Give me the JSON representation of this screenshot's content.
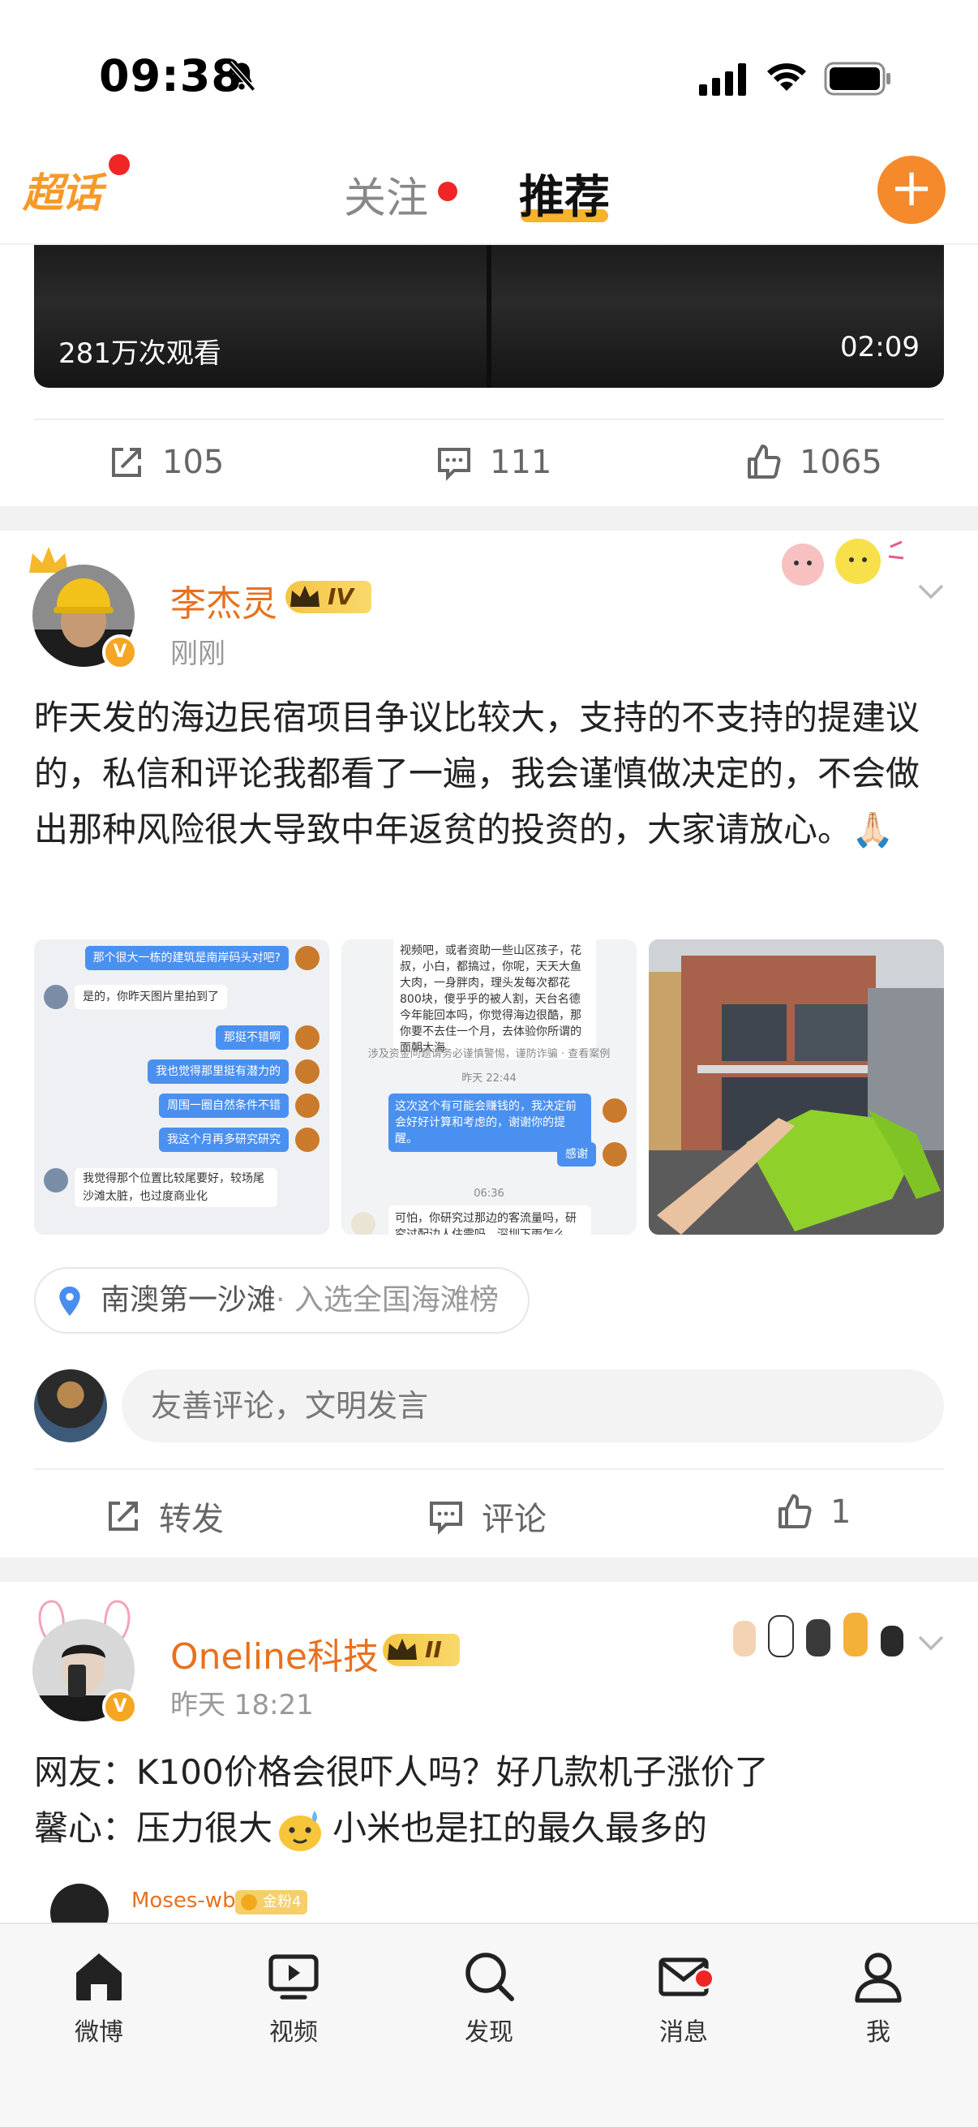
{
  "status_bar": {
    "time": "09:38"
  },
  "top_nav": {
    "chaohua_label": "超话",
    "tab_follow": "关注",
    "tab_recommend": "推荐",
    "plus": "+"
  },
  "video_card": {
    "views": "281万次观看",
    "duration": "02:09"
  },
  "post1_actions": {
    "repost": "105",
    "comment": "111",
    "like": "1065"
  },
  "post2": {
    "name": "李杰灵",
    "level": "IV",
    "time": "刚刚",
    "text": "昨天发的海边民宿项目争议比较大，支持的不支持的提建议的，私信和评论我都看了一遍，我会谨慎做决定的，不会做出那种风险很大导致中年返贫的投资的，大家请放心。🙏🏻",
    "thumb1": {
      "msgs": [
        {
          "side": "r",
          "text": "那个很大一栋的建筑是南岸码头对吧?"
        },
        {
          "side": "l",
          "text": "是的，你昨天图片里拍到了"
        },
        {
          "side": "r",
          "text": "那挺不错啊"
        },
        {
          "side": "r",
          "text": "我也觉得那里挺有潜力的"
        },
        {
          "side": "r",
          "text": "周围一圈自然条件不错"
        },
        {
          "side": "r",
          "text": "我这个月再多研究研究"
        },
        {
          "side": "l",
          "text": "我觉得那个位置比较尾要好，较场尾沙滩太脏，也过度商业化"
        }
      ]
    },
    "thumb2": {
      "top_text": "视频吧，或者资助一些山区孩子，花叔，小白，都搞过，你呢，天天大鱼大肉，一身胖肉，理头发每次都花800块，傻乎乎的被人割，天台名德今年能回本吗，你觉得海边很酷，那你要不去住一个月，去体验你所谓的面朝大海",
      "time1": "昨天 22:44",
      "reply": "这次这个有可能会赚钱的，我决定前会好好计算和考虑的，谢谢你的提醒。",
      "thanks": "感谢",
      "time2": "06:36",
      "bottom_text": "可怕，你研究过那边的客流量吗，研究过配边人住需吗，深圳下雨怎么办，台风怎"
    },
    "location": "南澳第一沙滩",
    "location_sub": "· 入选全国海滩榜",
    "comment_placeholder": "友善评论，文明发言",
    "actions": {
      "repost": "转发",
      "comment": "评论",
      "like": "1"
    }
  },
  "post3": {
    "name": "Oneline科技",
    "level": "II",
    "time": "昨天 18:21",
    "line1": "网友：K100价格会很吓人吗？好几款机子涨价了",
    "line2a": "馨心：压力很大",
    "line2b": "小米也是扛的最久最多的",
    "comment_user": "Moses-wb",
    "comment_badge": "金粉4"
  },
  "tabbar": {
    "items": [
      {
        "label": "微博",
        "icon": "home-icon"
      },
      {
        "label": "视频",
        "icon": "video-icon"
      },
      {
        "label": "发现",
        "icon": "search-icon"
      },
      {
        "label": "消息",
        "icon": "mail-icon"
      },
      {
        "label": "我",
        "icon": "profile-icon"
      }
    ]
  },
  "colors": {
    "accent": "#f58a2c",
    "name": "#e8711e",
    "badge_red": "#f02626",
    "tab_underline": "#f7b32b"
  }
}
